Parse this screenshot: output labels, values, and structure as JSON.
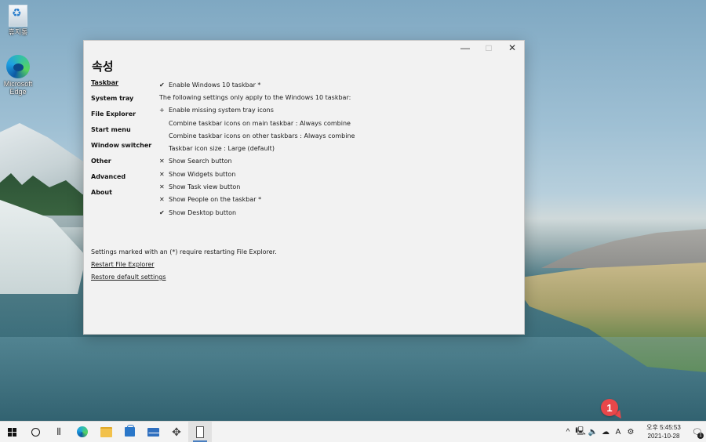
{
  "desktop": {
    "icons": [
      {
        "label": "휴지통",
        "icon": "recycle-bin-icon"
      },
      {
        "label": "Microsoft Edge",
        "icon": "edge-icon"
      }
    ]
  },
  "window": {
    "title": "속성",
    "controls": {
      "minimize": "—",
      "maximize": "□",
      "close": "✕"
    },
    "nav": [
      {
        "label": "Taskbar",
        "active": true
      },
      {
        "label": "System tray"
      },
      {
        "label": "File Explorer"
      },
      {
        "label": "Start menu"
      },
      {
        "label": "Window switcher"
      },
      {
        "label": "Other"
      },
      {
        "label": "Advanced"
      },
      {
        "label": "About"
      }
    ],
    "settings": [
      {
        "mark": "✔",
        "text": "Enable Windows 10 taskbar *"
      },
      {
        "mark": "",
        "text": "The following settings only apply to the Windows 10 taskbar:",
        "note": true
      },
      {
        "mark": "+",
        "text": "Enable missing system tray icons"
      },
      {
        "mark": "",
        "text": "Combine taskbar icons on main taskbar : Always combine"
      },
      {
        "mark": "",
        "text": "Combine taskbar icons on other taskbars : Always combine"
      },
      {
        "mark": "",
        "text": "Taskbar icon size : Large (default)"
      },
      {
        "mark": "✕",
        "text": "Show Search button"
      },
      {
        "mark": "✕",
        "text": "Show Widgets button"
      },
      {
        "mark": "✕",
        "text": "Show Task view button"
      },
      {
        "mark": "✕",
        "text": "Show People on the taskbar *"
      },
      {
        "mark": "✔",
        "text": "Show Desktop button"
      }
    ],
    "footer": {
      "note": "Settings marked with an (*) require restarting File Explorer.",
      "restart_link": "Restart File Explorer",
      "restore_link": "Restore default settings"
    }
  },
  "annotation": {
    "badge": "1"
  },
  "taskbar": {
    "apps": [
      {
        "name": "start-button",
        "icon": "windows-logo-icon"
      },
      {
        "name": "search-button",
        "icon": "search-circle-icon"
      },
      {
        "name": "task-view-button",
        "icon": "task-view-icon"
      },
      {
        "name": "edge-taskbar-button",
        "icon": "edge-icon"
      },
      {
        "name": "file-explorer-taskbar-button",
        "icon": "folder-icon"
      },
      {
        "name": "store-taskbar-button",
        "icon": "store-icon"
      },
      {
        "name": "mail-taskbar-button",
        "icon": "mail-icon"
      },
      {
        "name": "move-tool-taskbar-button",
        "icon": "move-icon"
      },
      {
        "name": "explorerpatcher-taskbar-button",
        "icon": "app-window-icon"
      }
    ],
    "tray": {
      "chevron": "^",
      "ime": "A",
      "clock_time": "오후 5:45:53",
      "clock_date": "2021-10-28",
      "notification_count": "1"
    }
  }
}
